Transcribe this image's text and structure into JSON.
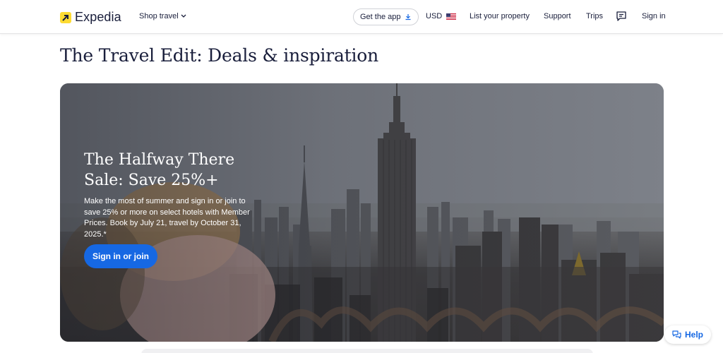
{
  "header": {
    "brand": "Expedia",
    "shop_travel": "Shop travel",
    "get_app": "Get the app",
    "currency": "USD",
    "list_property": "List your property",
    "support": "Support",
    "trips": "Trips",
    "sign_in": "Sign in"
  },
  "page": {
    "title": "The Travel Edit: Deals & inspiration"
  },
  "hero": {
    "heading": "The Halfway There Sale: Save 25%+",
    "body": "Make the most of summer and sign in or join to save 25% or more on select hotels with Member Prices. Book by July 21, travel by October 31, 2025.*",
    "cta": "Sign in or join"
  },
  "help": {
    "label": "Help"
  },
  "icons": {
    "logo": "arrow-up-right-icon",
    "shop_caret": "chevron-down-icon",
    "download": "download-icon",
    "flag": "us-flag-icon",
    "messages": "chat-icon",
    "help": "chat-bubbles-icon"
  },
  "colors": {
    "brand_yellow": "#fddb32",
    "primary_blue": "#1668e3",
    "text_dark": "#191e3b"
  }
}
